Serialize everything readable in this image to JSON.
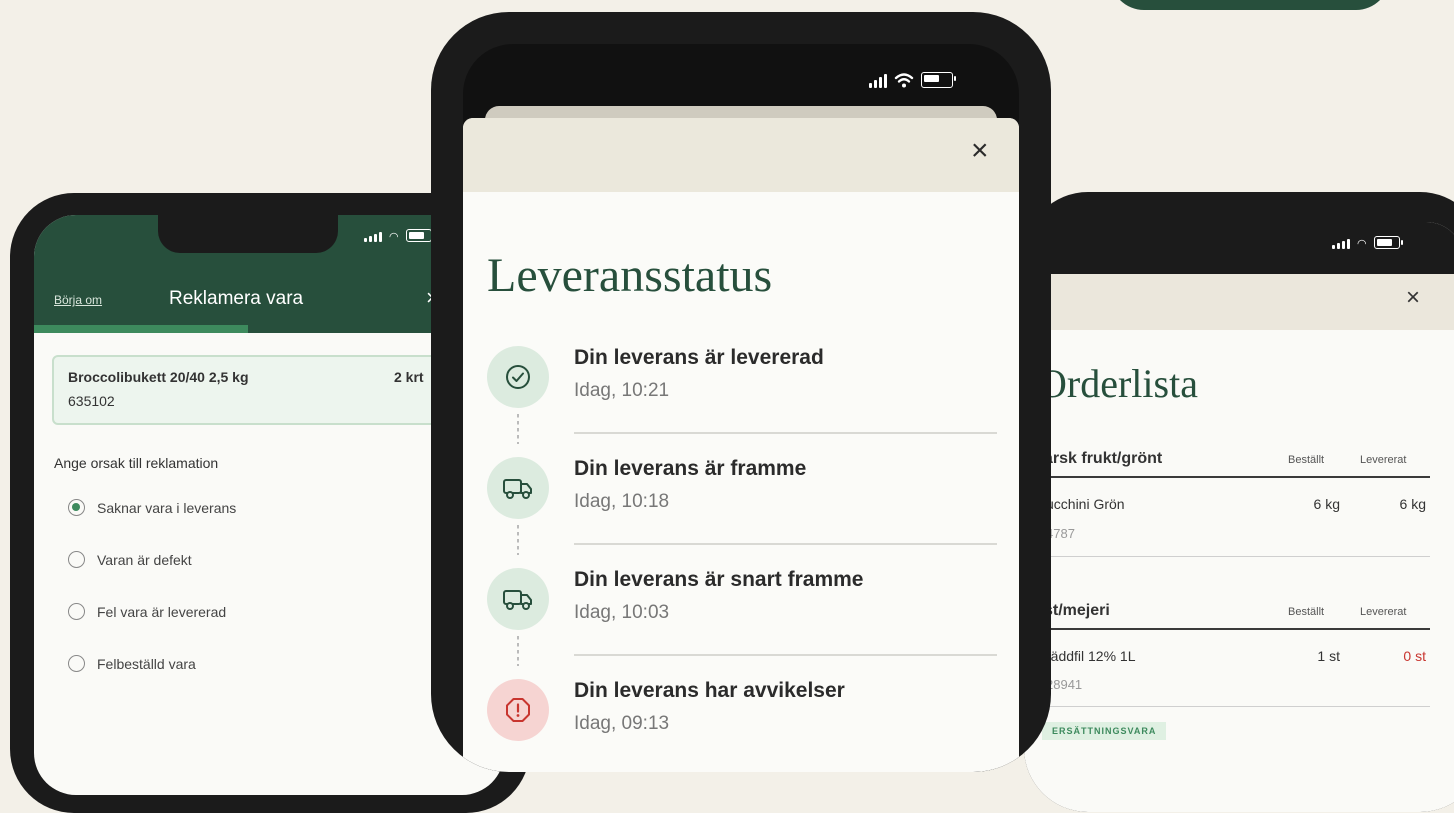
{
  "left_phone": {
    "start_over_link": "Börja om",
    "title": "Reklamera vara",
    "close_label": "×",
    "item": {
      "name": "Broccolibukett 20/40 2,5 kg",
      "code": "635102",
      "quantity": "2 krt"
    },
    "reason_label": "Ange orsak till reklamation",
    "options": [
      {
        "label": "Saknar vara i leverans",
        "selected": true
      },
      {
        "label": "Varan är defekt",
        "selected": false
      },
      {
        "label": "Fel vara är levererad",
        "selected": false
      },
      {
        "label": "Felbeställd vara",
        "selected": false
      }
    ]
  },
  "center_phone": {
    "close_label": "×",
    "title": "Leveransstatus",
    "steps": [
      {
        "title": "Din leverans är levererad",
        "time": "Idag, 10:21",
        "icon": "check-circle-icon",
        "status": "green"
      },
      {
        "title": "Din leverans är framme",
        "time": "Idag, 10:18",
        "icon": "truck-icon",
        "status": "green"
      },
      {
        "title": "Din leverans är snart framme",
        "time": "Idag, 10:03",
        "icon": "truck-icon",
        "status": "green"
      },
      {
        "title": "Din leverans har avvikelser",
        "time": "Idag, 09:13",
        "icon": "alert-octagon-icon",
        "status": "red"
      }
    ]
  },
  "right_phone": {
    "close_label": "×",
    "title": "Orderlista",
    "col_ordered": "Beställt",
    "col_delivered": "Levererat",
    "sections": [
      {
        "heading": "ärsk frukt/grönt",
        "item": {
          "name": "ucchini Grön",
          "code": "4787",
          "ordered": "6 kg",
          "delivered": "6 kg"
        }
      },
      {
        "heading": "st/mejeri",
        "item": {
          "name": "räddfil 12% 1L",
          "code": "28941",
          "ordered": "1 st",
          "delivered": "0 st"
        }
      }
    ],
    "badge": "ERSÄTTNINGSVARA"
  },
  "colors": {
    "brand_green": "#274f3c",
    "accent_green": "#3d8a5d",
    "alert_red": "#c8352f",
    "background": "#f3f0e8"
  }
}
